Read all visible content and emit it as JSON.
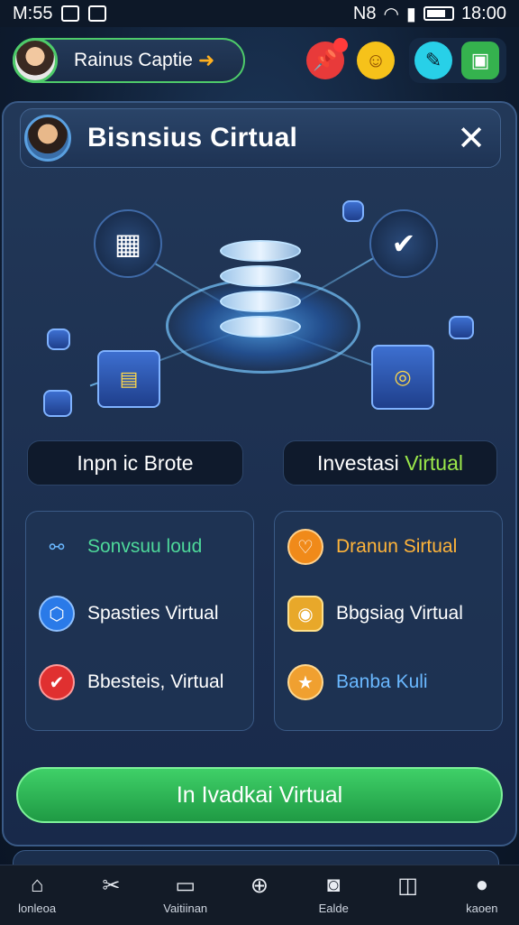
{
  "status_bar": {
    "time_left": "M:55",
    "time_right": "18:00",
    "signal_text": "N8"
  },
  "header": {
    "profile_name": "Rainus Captie"
  },
  "panel": {
    "title": "Bisnsius Cirtual"
  },
  "hero_buttons": {
    "left_label": "Inpn ic Brote",
    "right_label_a": "Investasi ",
    "right_label_b": "Virtual"
  },
  "left_list": [
    {
      "label": "Sonvsuu loud",
      "color": "#4ed89a"
    },
    {
      "label": "Spasties Virtual",
      "color": "#ffffff"
    },
    {
      "label": "Bbesteis, Virtual",
      "color": "#ffffff"
    }
  ],
  "right_list": [
    {
      "label": "Dranun Sirtual",
      "color": "#ffb43a"
    },
    {
      "label": "Bbgsiag Virtual",
      "color": "#ffffff"
    },
    {
      "label": "Banba Kuli",
      "color": "#6ab8ff"
    }
  ],
  "cta": {
    "label": "In Ivadkai Virtual"
  },
  "bottom_nav": [
    {
      "label": "lonleoa",
      "icon": "home-icon"
    },
    {
      "label": "",
      "icon": "tools-icon"
    },
    {
      "label": "Vaitiinan",
      "icon": "frame-icon"
    },
    {
      "label": "",
      "icon": "plus-circle-icon"
    },
    {
      "label": "Ealde",
      "icon": "camera-icon"
    },
    {
      "label": "",
      "icon": "columns-icon"
    },
    {
      "label": "kaoen",
      "icon": "user-icon"
    }
  ]
}
